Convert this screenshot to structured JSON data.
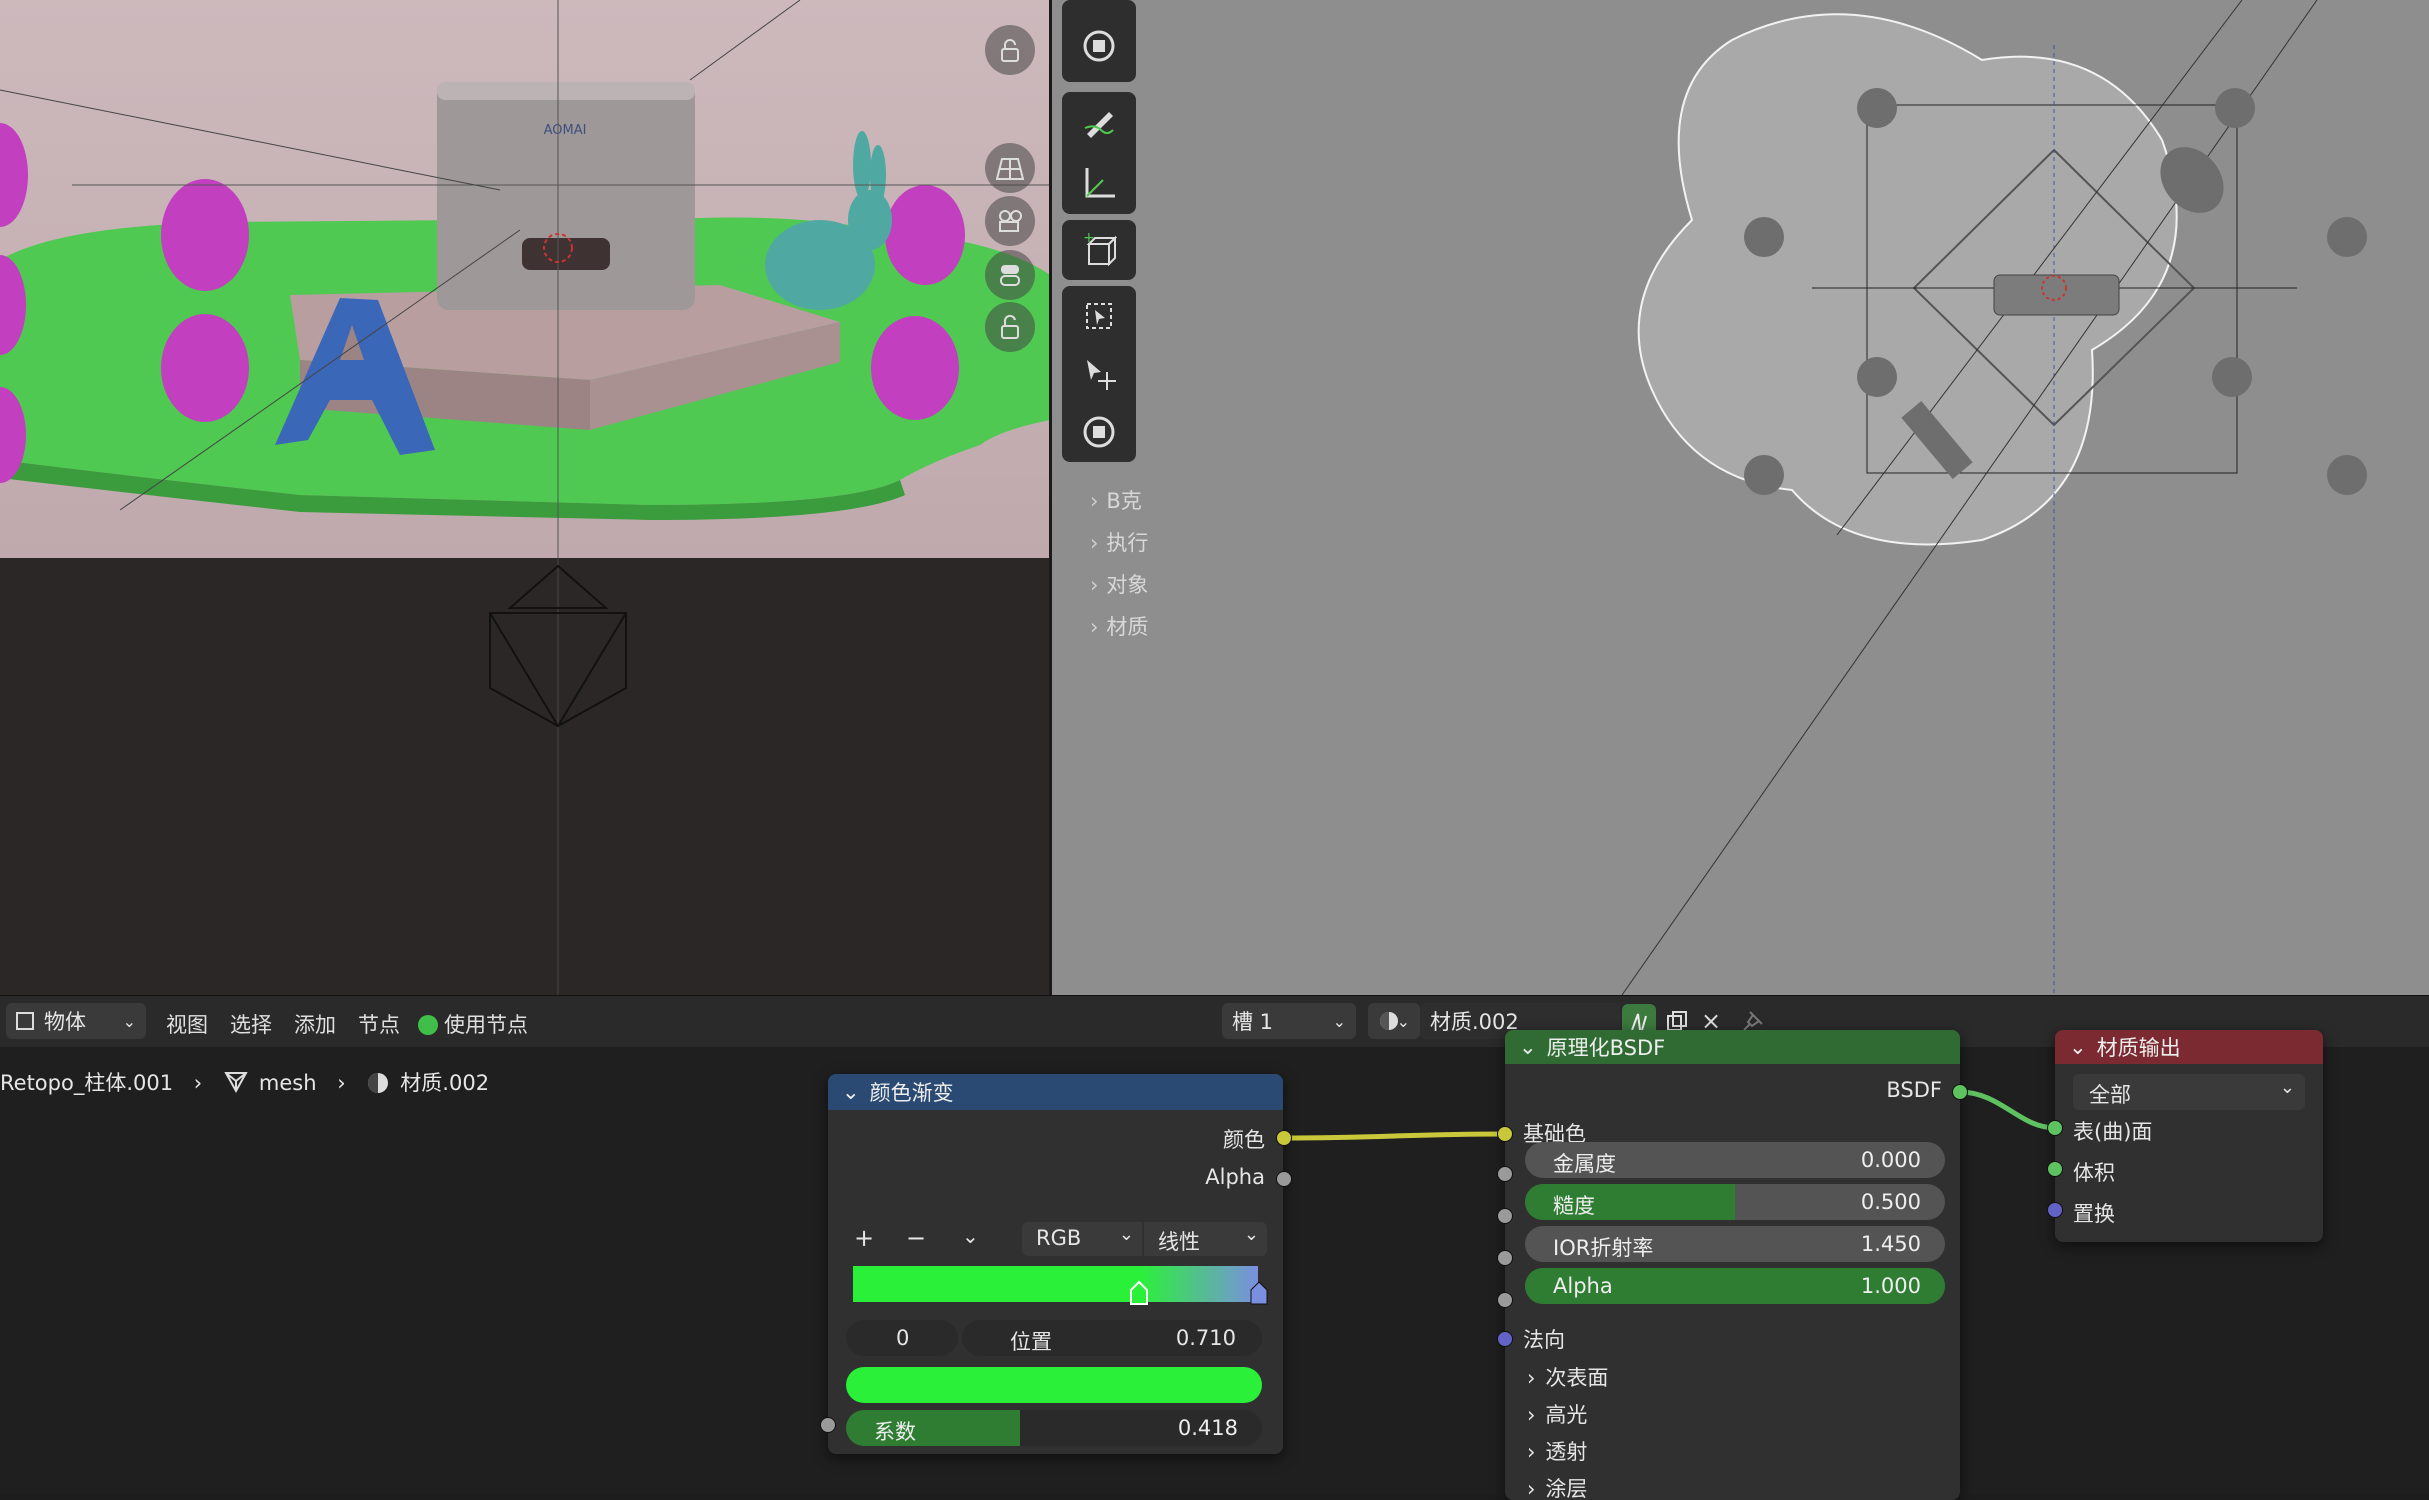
{
  "render_view": {
    "logo_text": "AOMAI",
    "accent_colors": {
      "ground": "#58d35a",
      "eggs": "#c23fbf",
      "letter": "#3b67b8",
      "bunny": "#4fa9a2",
      "background": "#c9b5b8"
    }
  },
  "viewport_panel": {
    "items": [
      {
        "label": "B克"
      },
      {
        "label": "执行"
      },
      {
        "label": "对象"
      },
      {
        "label": "材质"
      }
    ]
  },
  "header": {
    "mode": "物体",
    "menus": [
      "视图",
      "选择",
      "添加",
      "节点"
    ],
    "use_nodes_label": "使用节点",
    "slot": "槽 1",
    "material_name": "材质.002"
  },
  "breadcrumb": {
    "object": "Retopo_柱体.001",
    "mesh": "mesh",
    "material": "材质.002"
  },
  "color_ramp_node": {
    "title": "颜色渐变",
    "out_color": "颜色",
    "out_alpha": "Alpha",
    "color_mode": "RGB",
    "interpolation": "线性",
    "stop_index": "0",
    "position_label": "位置",
    "position_value": "0.710",
    "factor_label": "系数",
    "factor_value": "0.418",
    "factor_fraction": 0.418,
    "ramp_colors": [
      "#2bf03a",
      "#7a8fe0"
    ]
  },
  "bsdf_node": {
    "title": "原理化BSDF",
    "output": "BSDF",
    "base_color_label": "基础色",
    "fields": [
      {
        "label": "金属度",
        "value": "0.000",
        "fraction": 0.0
      },
      {
        "label": "糙度",
        "value": "0.500",
        "fraction": 0.5
      },
      {
        "label": "IOR折射率",
        "value": "1.450",
        "fraction": 0.0
      },
      {
        "label": "Alpha",
        "value": "1.000",
        "fraction": 1.0
      }
    ],
    "normal_label": "法向",
    "panels": [
      "次表面",
      "高光",
      "透射",
      "涂层"
    ]
  },
  "output_node": {
    "title": "材质输出",
    "target": "全部",
    "sockets": [
      "表(曲)面",
      "体积",
      "置换"
    ]
  }
}
